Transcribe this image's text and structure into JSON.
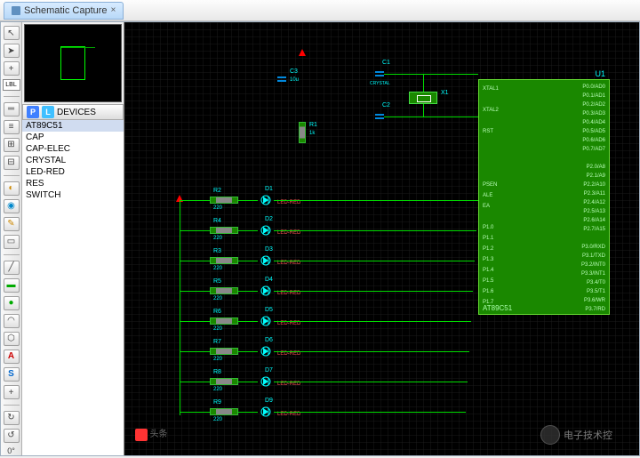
{
  "tab": {
    "title": "Schematic Capture",
    "close": "×"
  },
  "toolbar": {
    "items": [
      "arrow",
      "plus",
      "right",
      "lbl",
      "t1",
      "t2",
      "t3",
      "t4",
      "t5",
      "t6",
      "t7",
      "t8",
      "t9",
      "t10",
      "t11",
      "t12",
      "t13",
      "A",
      "S",
      "plus2",
      "t14"
    ],
    "lbl_text": "LBL"
  },
  "devices": {
    "header": "DEVICES",
    "p": "P",
    "l": "L",
    "items": [
      "AT89C51",
      "CAP",
      "CAP-ELEC",
      "CRYSTAL",
      "LED-RED",
      "RES",
      "SWITCH"
    ],
    "selected": 0
  },
  "chip": {
    "ref": "U1",
    "name": "AT89C51",
    "left_pins": [
      "XTAL1",
      "",
      "XTAL2",
      "",
      "RST",
      "",
      "",
      "",
      "",
      "PSEN",
      "ALE",
      "EA",
      "",
      "P1.0",
      "P1.1",
      "P1.2",
      "P1.3",
      "P1.4",
      "P1.5",
      "P1.6",
      "P1.7"
    ],
    "right_pins": [
      "P0.0/AD0",
      "P0.1/AD1",
      "P0.2/AD2",
      "P0.3/AD3",
      "P0.4/AD4",
      "P0.5/AD5",
      "P0.6/AD6",
      "P0.7/AD7",
      "",
      "P2.0/A8",
      "P2.1/A9",
      "P2.2/A10",
      "P2.3/A11",
      "P2.4/A12",
      "P2.5/A13",
      "P2.6/A14",
      "P2.7/A15",
      "",
      "P3.0/RXD",
      "P3.1/TXD",
      "P3.2/INT0",
      "P3.3/INT1",
      "P3.4/T0",
      "P3.5/T1",
      "P3.6/WR",
      "P3.7/RD"
    ]
  },
  "components": {
    "caps": [
      {
        "ref": "C3",
        "sub": "10u"
      },
      {
        "ref": "C1",
        "sub": "CRYSTAL"
      },
      {
        "ref": "C2",
        "sub": ""
      }
    ],
    "xtal": {
      "ref": "X1"
    },
    "r1": {
      "ref": "R1",
      "val": "1k"
    },
    "rows": [
      {
        "r": "R2",
        "d": "D1",
        "rv": "220",
        "dv": "LED-RED"
      },
      {
        "r": "R4",
        "d": "D2",
        "rv": "220",
        "dv": "LED-RED"
      },
      {
        "r": "R3",
        "d": "D3",
        "rv": "220",
        "dv": "LED-RED"
      },
      {
        "r": "R5",
        "d": "D4",
        "rv": "220",
        "dv": "LED-RED"
      },
      {
        "r": "R6",
        "d": "D5",
        "rv": "220",
        "dv": "LED-RED"
      },
      {
        "r": "R7",
        "d": "D6",
        "rv": "220",
        "dv": "LED-RED"
      },
      {
        "r": "R8",
        "d": "D7",
        "rv": "220",
        "dv": "LED-RED"
      },
      {
        "r": "R9",
        "d": "D9",
        "rv": "220",
        "dv": "LED-RED"
      }
    ]
  },
  "watermark": {
    "text": "电子技术控",
    "toutiao": "头条"
  }
}
